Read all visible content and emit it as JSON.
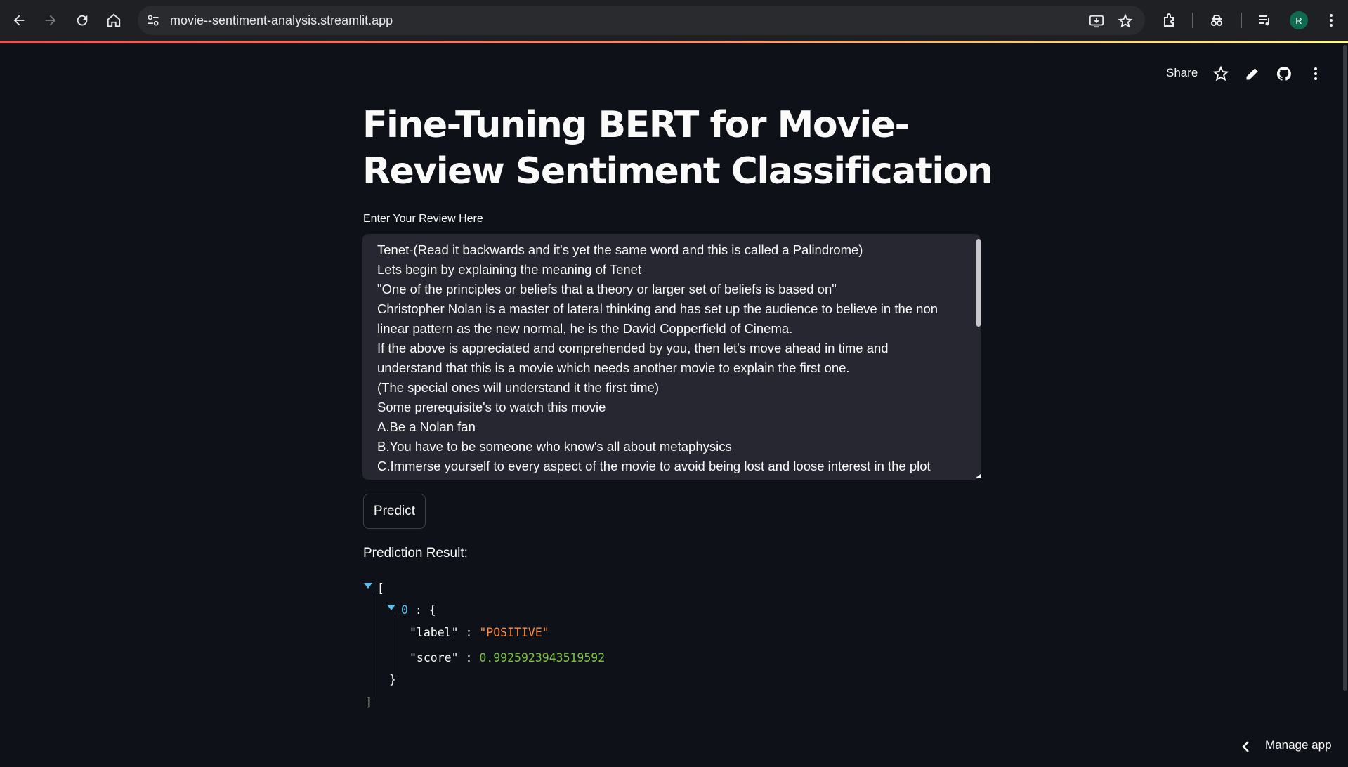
{
  "browser": {
    "url": "movie--sentiment-analysis.streamlit.app",
    "avatar_initial": "R"
  },
  "header": {
    "share_label": "Share"
  },
  "main": {
    "title": "Fine-Tuning BERT for Movie-Review Sentiment Classification",
    "review_label": "Enter Your Review Here",
    "review_text": "Tenet-(Read it backwards and it's yet the same word and this is called a Palindrome)\nLets begin by explaining the meaning of Tenet\n\"One of the principles or beliefs that a theory or larger set of beliefs is based on\"\nChristopher Nolan is a master of lateral thinking and has set up the audience to believe in the non linear pattern as the new normal, he is the David Copperfield of Cinema.\nIf the above is appreciated and comprehended by you, then let's move ahead in time and understand that this is a movie which needs another movie to explain the first one.\n(The special ones will understand it the first time)\nSome prerequisite's to watch this movie\nA.Be a Nolan fan\nB.You have to be someone who know's all about metaphysics\nC.Immerse yourself to every aspect of the movie to avoid being lost and loose interest in the plot",
    "predict_label": "Predict",
    "result_label": "Prediction Result:",
    "result": {
      "index": "0",
      "label_key": "\"label\"",
      "label_value": "\"POSITIVE\"",
      "score_key": "\"score\"",
      "score_value": "0.9925923943519592"
    }
  },
  "footer": {
    "manage_label": "Manage app"
  },
  "colors": {
    "background": "#0e1117",
    "accent": "#ff4b4b",
    "json_string": "#ff8c42",
    "json_number": "#7ac143",
    "json_index": "#5bc0eb"
  }
}
